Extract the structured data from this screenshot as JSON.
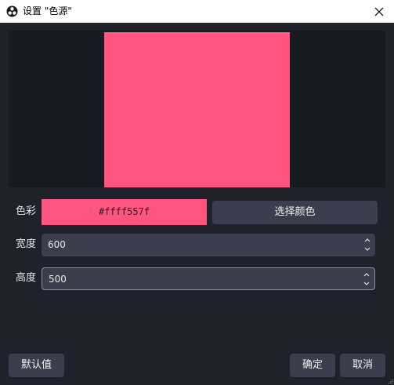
{
  "window": {
    "title": "设置 \"色源\"",
    "icon": "obs-icon",
    "close_icon": "close-icon"
  },
  "preview": {
    "swatch_color": "#ff557f"
  },
  "form": {
    "color_label": "色彩",
    "color_value": "#ffff557f",
    "select_color_label": "选择颜色",
    "width_label": "宽度",
    "width_value": "600",
    "height_label": "高度",
    "height_value": "500"
  },
  "footer": {
    "defaults_label": "默认值",
    "ok_label": "确定",
    "cancel_label": "取消"
  },
  "colors": {
    "background": "#1f212b",
    "preview_background": "#181a22",
    "button": "#3b3f4d",
    "accent": "#ff557f"
  }
}
